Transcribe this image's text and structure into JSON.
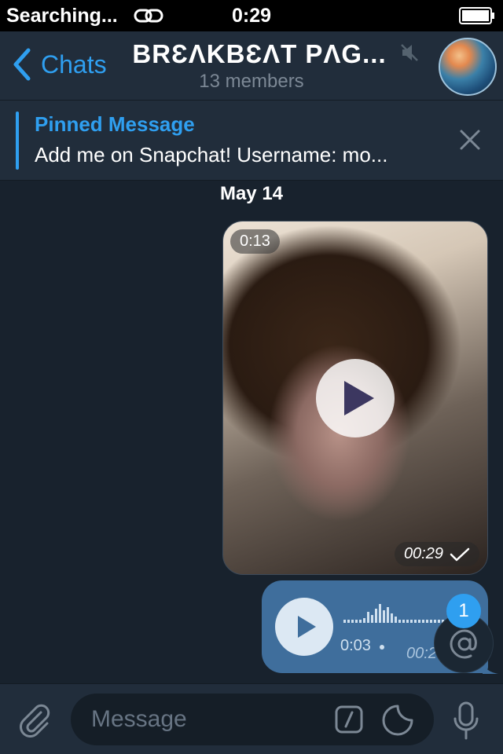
{
  "status_bar": {
    "carrier": "Searching...",
    "time": "0:29",
    "icons": [
      "link-icon",
      "battery-icon"
    ]
  },
  "nav": {
    "back_label": "Chats",
    "title": "BRƐΛKBƐΛT PΛG...",
    "subtitle": "13 members",
    "icons": [
      "chevron-left-icon",
      "mute-icon",
      "group-avatar"
    ]
  },
  "pinned": {
    "title": "Pinned Message",
    "text": "Add me on Snapchat! Username: mo...",
    "close_icon": "close-icon"
  },
  "messages": {
    "date": "May 14",
    "video": {
      "duration": "0:13",
      "time": "00:29",
      "status_icon": "check-icon"
    },
    "voice": {
      "duration": "0:03",
      "time": "00:2"
    }
  },
  "mention": {
    "count": "1",
    "icon": "at-icon"
  },
  "input": {
    "placeholder": "Message",
    "icons": [
      "paperclip-icon",
      "command-icon",
      "sticker-icon",
      "microphone-icon"
    ]
  },
  "colors": {
    "accent": "#2f9ff0",
    "background": "#18222d",
    "bar": "#212d3b",
    "outgoing_bubble": "#3f6e9c"
  }
}
